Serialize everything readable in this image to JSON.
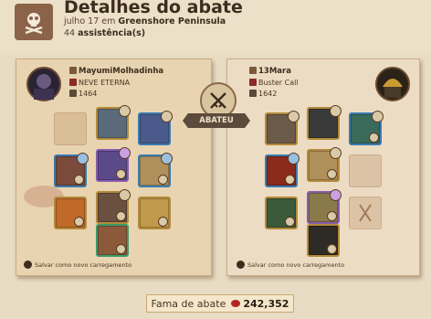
{
  "header": {
    "title": "Detalhes do abate",
    "date": "julho 17 em",
    "location": "Greenshore Peninsula",
    "assist_count": "44",
    "assist_label": "assistência(s)"
  },
  "killer": {
    "name": "MayumiMolhadinha",
    "guild": "NEVE ETERNA",
    "fame": "1464",
    "save_label": "Salvar como novo carregamento",
    "icon": "skull-avatar"
  },
  "victim": {
    "name": "13Mara",
    "guild": "Buster Call",
    "fame": "1642",
    "save_label": "Salvar como novo carregamento",
    "icon": "helmet-avatar"
  },
  "center": {
    "label": "ABATEU",
    "icon": "crossed-swords-icon"
  },
  "footer": {
    "label": "Fama de abate",
    "value": "242,352",
    "icon": "blood-drop-icon"
  },
  "colors": {
    "accent": "#b48a3a",
    "blood": "#b3261e",
    "ribbon": "#5c4a3c"
  }
}
